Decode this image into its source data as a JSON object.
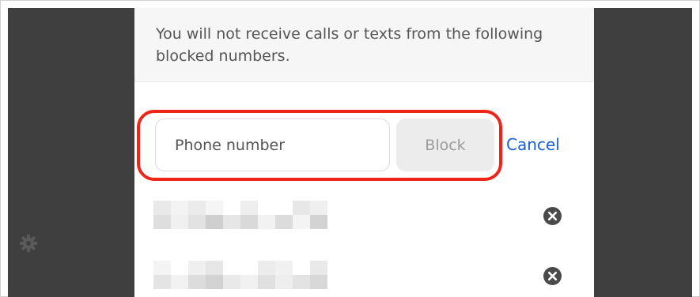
{
  "dialog": {
    "description": "You will not receive calls or texts from the following blocked numbers.",
    "phone_input": {
      "placeholder": "Phone number",
      "value": ""
    },
    "block_button_label": "Block",
    "cancel_label": "Cancel"
  },
  "blocked_numbers": [
    {
      "number_redacted": true,
      "remove_icon": "close-circle-icon"
    },
    {
      "number_redacted": true,
      "remove_icon": "close-circle-icon"
    }
  ],
  "sidebar": {
    "settings_icon": "gear-icon"
  },
  "colors": {
    "overlay": "#3f3f3f",
    "highlight": "#f0251a",
    "link": "#1a5fd6",
    "disabled_button_bg": "#ececec",
    "disabled_button_text": "#9b9b9b"
  }
}
